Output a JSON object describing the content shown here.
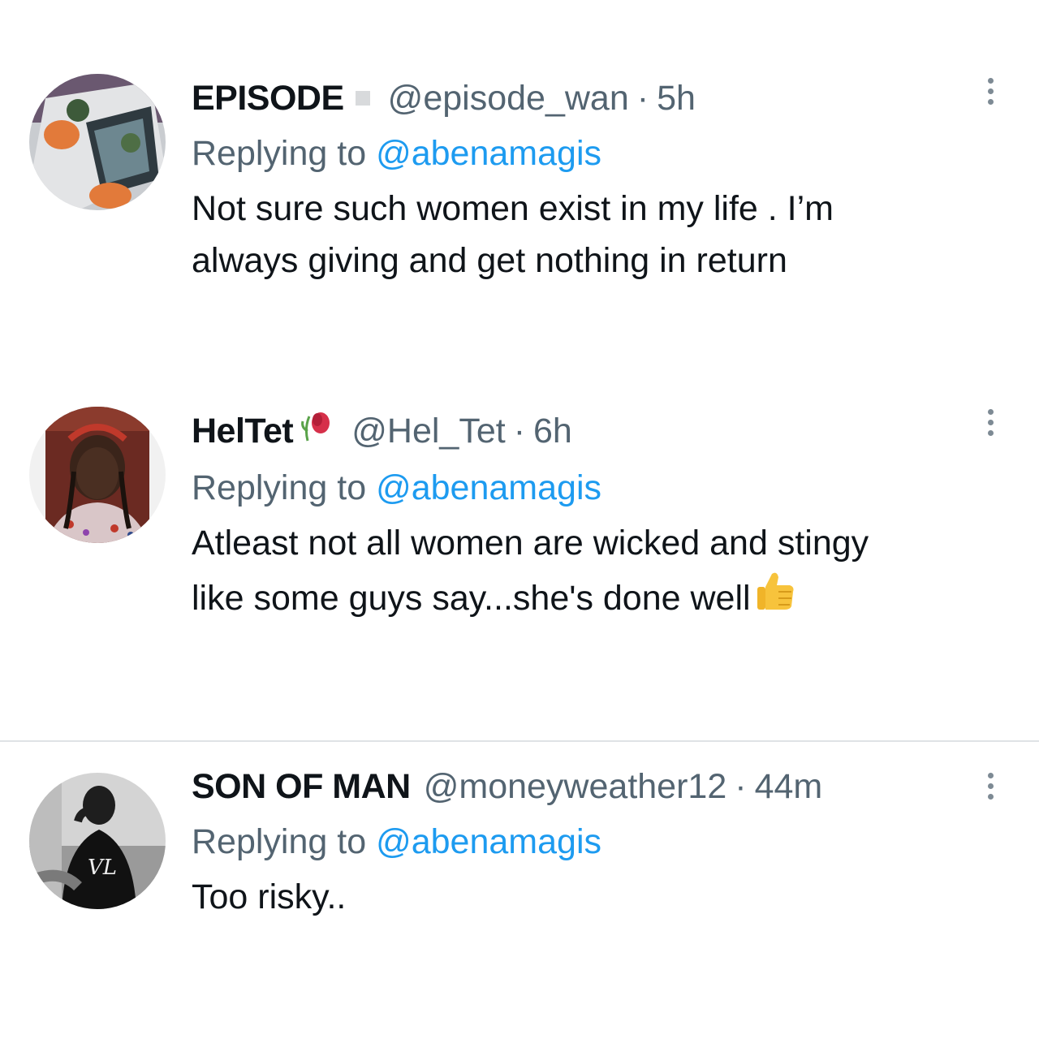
{
  "tweets": [
    {
      "display_name": "EPISODE",
      "handle": "@episode_wan",
      "separator": "·",
      "time": "5h",
      "replying_prefix": "Replying to ",
      "replying_to": "@abenamagis",
      "body_line1": "Not sure such women exist in my life . I’m",
      "body_line2": "always giving and get nothing in return",
      "avatar_icon": "avatar-episode",
      "more_icon": "more-vertical-icon"
    },
    {
      "display_name": "HelTet",
      "name_emoji": "wilted-rose-emoji",
      "handle": "@Hel_Tet",
      "separator": "·",
      "time": "6h",
      "replying_prefix": "Replying to ",
      "replying_to": "@abenamagis",
      "body_line1": "Atleast not all women are wicked and stingy",
      "body_line2": "like some guys say...she's done well",
      "body_emoji": "thumbs-up-emoji",
      "avatar_icon": "avatar-heltet",
      "more_icon": "more-vertical-icon"
    },
    {
      "display_name": "SON OF MAN",
      "handle": "@moneyweather12",
      "separator": "·",
      "time": "44m",
      "replying_prefix": "Replying to ",
      "replying_to": "@abenamagis",
      "body_line1": "Too risky..",
      "avatar_icon": "avatar-son-of-man",
      "more_icon": "more-vertical-icon"
    }
  ],
  "colors": {
    "text_primary": "#0f1419",
    "text_secondary": "#536471",
    "mention_blue": "#1d9bf0",
    "divider": "#dfe3e6",
    "emoji_yellow": "#f7c33c"
  }
}
